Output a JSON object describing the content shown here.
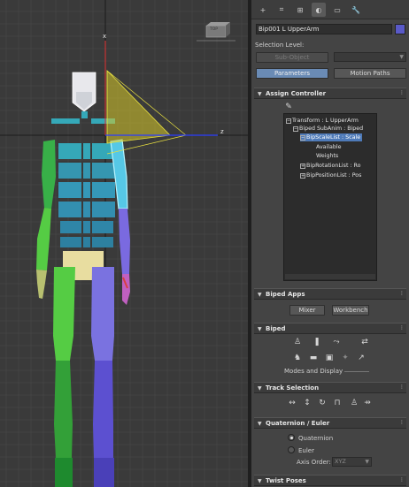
{
  "viewport": {
    "axis_x": "x",
    "axis_z": "z",
    "viewcube_label": "TOP"
  },
  "panel": {
    "tabs": [
      {
        "name": "create",
        "glyph": "+"
      },
      {
        "name": "modify",
        "glyph": "⌗"
      },
      {
        "name": "hierarchy",
        "glyph": "⊞"
      },
      {
        "name": "motion",
        "glyph": "◐"
      },
      {
        "name": "display",
        "glyph": "▭"
      },
      {
        "name": "utilities",
        "glyph": "🔧"
      }
    ],
    "object_name": "Bip001 L UpperArm",
    "object_color": "#5a5ac8",
    "selection_level_label": "Selection Level:",
    "sub_object_button": "Sub-Object",
    "parameters_button": "Parameters",
    "motion_paths_button": "Motion Paths",
    "rollouts": {
      "assign_controller": "Assign Controller",
      "biped_apps": "Biped Apps",
      "biped": "Biped",
      "track_selection": "Track Selection",
      "quaternion_euler": "Quaternion / Euler",
      "twist_poses": "Twist Poses"
    },
    "tree": [
      "Transform : L UpperArm",
      "Biped SubAnim : Biped",
      "BipScaleList : Scale",
      "Available",
      "Weights",
      "BipRotationList : Ro",
      "BipPositionList : Pos"
    ],
    "mixer_button": "Mixer",
    "workbench_button": "Workbench",
    "modes_and_display": "Modes and Display",
    "quaternion_label": "Quaternion",
    "euler_label": "Euler",
    "axis_order_label": "Axis Order:",
    "axis_order_value": "XYZ"
  }
}
